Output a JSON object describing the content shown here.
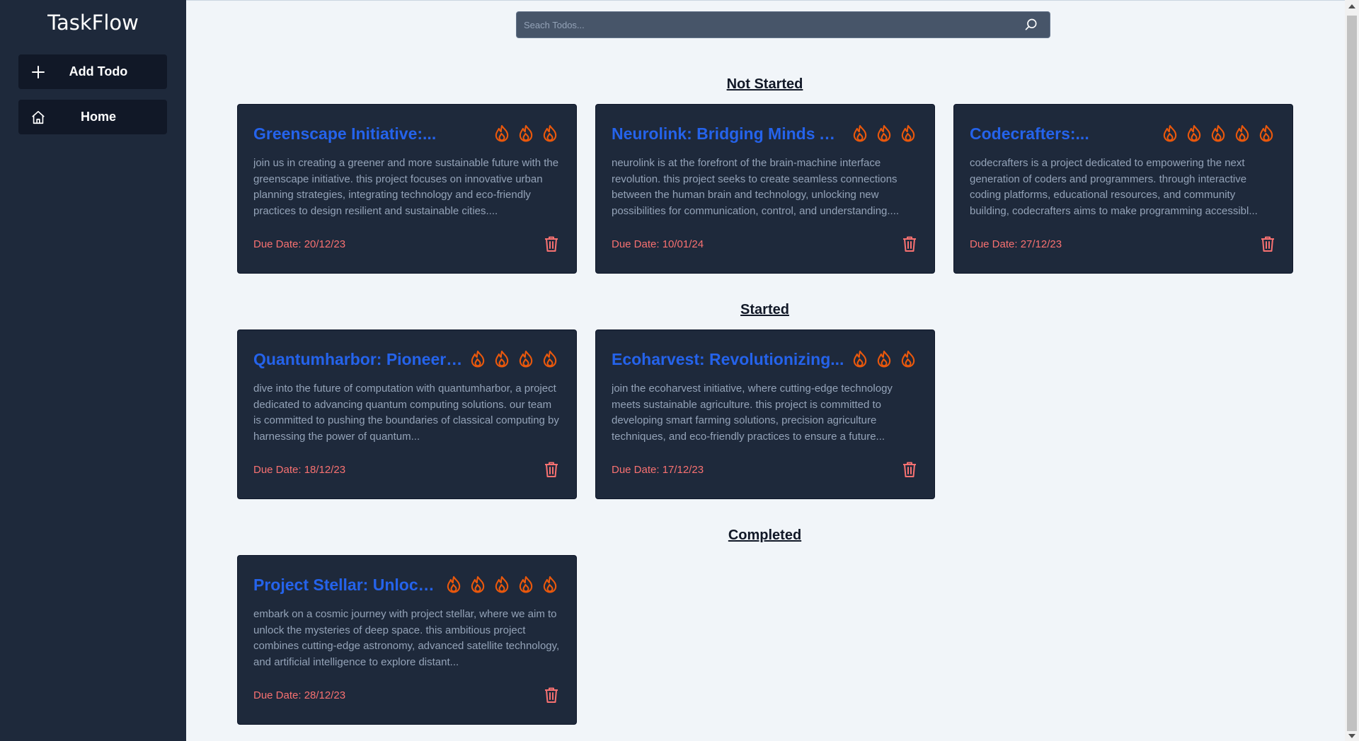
{
  "app": {
    "title": "TaskFlow"
  },
  "sidebar": {
    "items": [
      {
        "label": "Add Todo",
        "icon": "plus-icon"
      },
      {
        "label": "Home",
        "icon": "home-icon"
      }
    ]
  },
  "search": {
    "placeholder": "Seach Todos..."
  },
  "colors": {
    "sidebar_bg": "#1e293b",
    "card_bg": "#1e293b",
    "title": "#2563eb",
    "flame": "#ea580c",
    "due": "#f87171",
    "page_bg": "#f1f5f9"
  },
  "sections": [
    {
      "title": "Not Started",
      "cards": [
        {
          "title": "Greenscape Initiative:...",
          "priority": 3,
          "description": "join us in creating a greener and more sustainable future with the greenscape initiative. this project focuses on innovative urban planning strategies, integrating technology and eco-friendly practices to design resilient and sustainable cities....",
          "due": "Due Date: 20/12/23"
        },
        {
          "title": "Neurolink: Bridging Minds And...",
          "priority": 3,
          "description": "neurolink is at the forefront of the brain-machine interface revolution. this project seeks to create seamless connections between the human brain and technology, unlocking new possibilities for communication, control, and understanding....",
          "due": "Due Date: 10/01/24"
        },
        {
          "title": "Codecrafters:...",
          "priority": 5,
          "description": "codecrafters is a project dedicated to empowering the next generation of coders and programmers. through interactive coding platforms, educational resources, and community building, codecrafters aims to make programming accessibl...",
          "due": "Due Date: 27/12/23"
        }
      ]
    },
    {
      "title": "Started",
      "cards": [
        {
          "title": "Quantumharbor: Pioneerin...",
          "priority": 4,
          "description": "dive into the future of computation with quantumharbor, a project dedicated to advancing quantum computing solutions. our team is committed to pushing the boundaries of classical computing by harnessing the power of quantum...",
          "due": "Due Date: 18/12/23"
        },
        {
          "title": "Ecoharvest: Revolutionizing...",
          "priority": 3,
          "description": "join the ecoharvest initiative, where cutting-edge technology meets sustainable agriculture. this project is committed to developing smart farming solutions, precision agriculture techniques, and eco-friendly practices to ensure a future...",
          "due": "Due Date: 17/12/23"
        }
      ]
    },
    {
      "title": "Completed",
      "cards": [
        {
          "title": "Project Stellar: Unlockin...",
          "priority": 5,
          "description": "embark on a cosmic journey with project stellar, where we aim to unlock the mysteries of deep space. this ambitious project combines cutting-edge astronomy, advanced satellite technology, and artificial intelligence to explore distant...",
          "due": "Due Date: 28/12/23"
        }
      ]
    }
  ]
}
